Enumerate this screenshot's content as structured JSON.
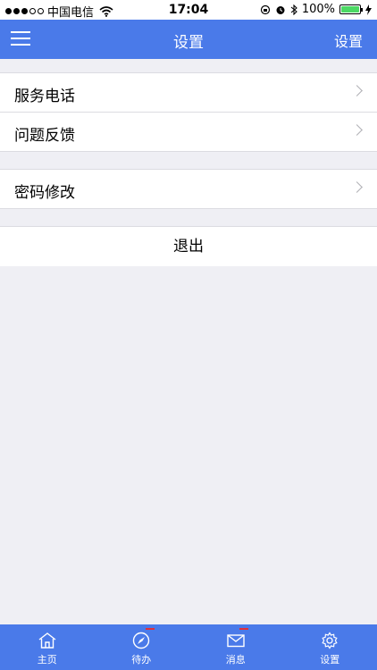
{
  "status_bar": {
    "carrier": "中国电信",
    "time": "17:04",
    "battery": "100%"
  },
  "nav": {
    "title": "设置",
    "right_button": "设置"
  },
  "groups": [
    {
      "items": [
        {
          "label": "服务电话"
        },
        {
          "label": "问题反馈"
        }
      ]
    },
    {
      "items": [
        {
          "label": "密码修改"
        }
      ]
    }
  ],
  "logout_label": "退出",
  "tabs": [
    {
      "label": "主页",
      "icon": "home-icon"
    },
    {
      "label": "待办",
      "icon": "compass-icon"
    },
    {
      "label": "消息",
      "icon": "mail-icon"
    },
    {
      "label": "设置",
      "icon": "gear-icon"
    }
  ],
  "colors": {
    "accent": "#4a7ae9",
    "background": "#efeff4",
    "badge": "#e0303a",
    "battery": "#4cd964"
  }
}
